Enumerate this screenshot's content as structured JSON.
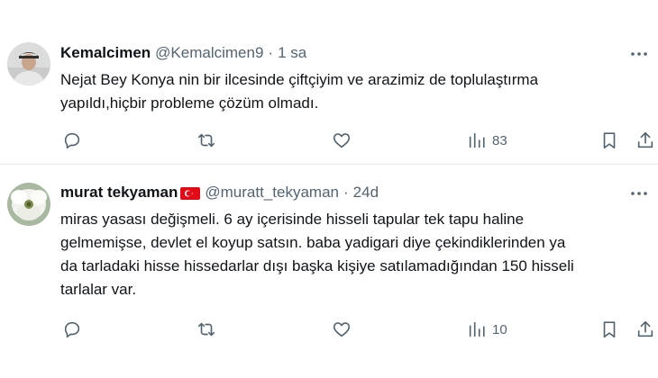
{
  "replies": [
    {
      "display_name": "Kemalcimen",
      "handle": "@Kemalcimen9",
      "separator": "·",
      "time": "1 sa",
      "text_lines": [
        "Nejat Bey Konya nin bir ilcesinde çiftçiyim ve arazimiz de toplulaştırma",
        "yapıldı,hiçbir probleme çözüm olmadı."
      ],
      "views": "83"
    },
    {
      "display_name": "murat tekyaman",
      "flag": "turkey-flag-emoji",
      "handle": "@muratt_tekyaman",
      "separator": "·",
      "time": "24d",
      "text_lines": [
        "miras yasası değişmeli. 6 ay içerisinde hisseli tapular tek tapu haline",
        "gelmemişse, devlet el koyup satsın. baba yadigari diye çekindiklerinden ya",
        "da tarladaki hisse hissedarlar dışı başka kişiye satılamadığından 150 hisseli",
        "tarlalar var."
      ],
      "views": "10"
    }
  ],
  "icons": {
    "reply": "reply-icon",
    "repost": "repost-icon",
    "like": "like-icon",
    "views": "views-icon",
    "bookmark": "bookmark-icon",
    "share": "share-icon",
    "more": "more-icon"
  },
  "colors": {
    "text": "#0f1419",
    "secondary": "#536471",
    "divider": "#e6e9eb",
    "flag_red": "#e30a17"
  }
}
